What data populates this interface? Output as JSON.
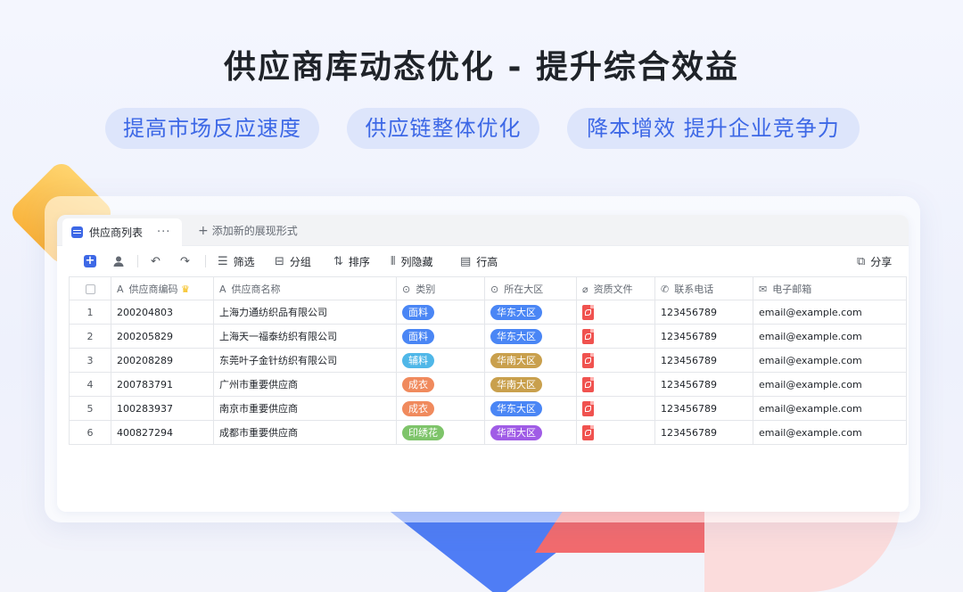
{
  "title": "供应商库动态优化 - 提升综合效益",
  "pills": [
    "提高市场反应速度",
    "供应链整体优化",
    "降本增效 提升企业竞争力"
  ],
  "tabs": {
    "active_label": "供应商列表",
    "more": "···",
    "add_label": "添加新的展现形式"
  },
  "toolbar": {
    "filter": "筛选",
    "group": "分组",
    "sort": "排序",
    "hide_columns": "列隐藏",
    "row_height": "行高",
    "share": "分享"
  },
  "table": {
    "headers": [
      "供应商编码",
      "供应商名称",
      "类别",
      "所在大区",
      "资质文件",
      "联系电话",
      "电子邮箱"
    ],
    "rows": [
      {
        "idx": "1",
        "code": "200204803",
        "name": "上海力通纺织品有限公司",
        "category": "面料",
        "region": "华东大区",
        "phone": "123456789",
        "email": "email@example.com"
      },
      {
        "idx": "2",
        "code": "200205829",
        "name": "上海天一福泰纺织有限公司",
        "category": "面料",
        "region": "华东大区",
        "phone": "123456789",
        "email": "email@example.com"
      },
      {
        "idx": "3",
        "code": "200208289",
        "name": "东莞叶子金针纺织有限公司",
        "category": "辅料",
        "region": "华南大区",
        "phone": "123456789",
        "email": "email@example.com"
      },
      {
        "idx": "4",
        "code": "200783791",
        "name": "广州市重要供应商",
        "category": "成衣",
        "region": "华南大区",
        "phone": "123456789",
        "email": "email@example.com"
      },
      {
        "idx": "5",
        "code": "100283937",
        "name": "南京市重要供应商",
        "category": "成衣",
        "region": "华东大区",
        "phone": "123456789",
        "email": "email@example.com"
      },
      {
        "idx": "6",
        "code": "400827294",
        "name": "成都市重要供应商",
        "category": "印绣花",
        "region": "华西大区",
        "phone": "123456789",
        "email": "email@example.com"
      }
    ]
  },
  "colors": {
    "accent": "#3d68e6",
    "tag_面料": "#4a86f5",
    "tag_辅料": "#4fb7e8",
    "tag_成衣": "#f08a5d",
    "tag_印绣花": "#7ec46a",
    "region_华东大区": "#4a86f5",
    "region_华南大区": "#c9a04d",
    "region_华西大区": "#a05ce6"
  }
}
